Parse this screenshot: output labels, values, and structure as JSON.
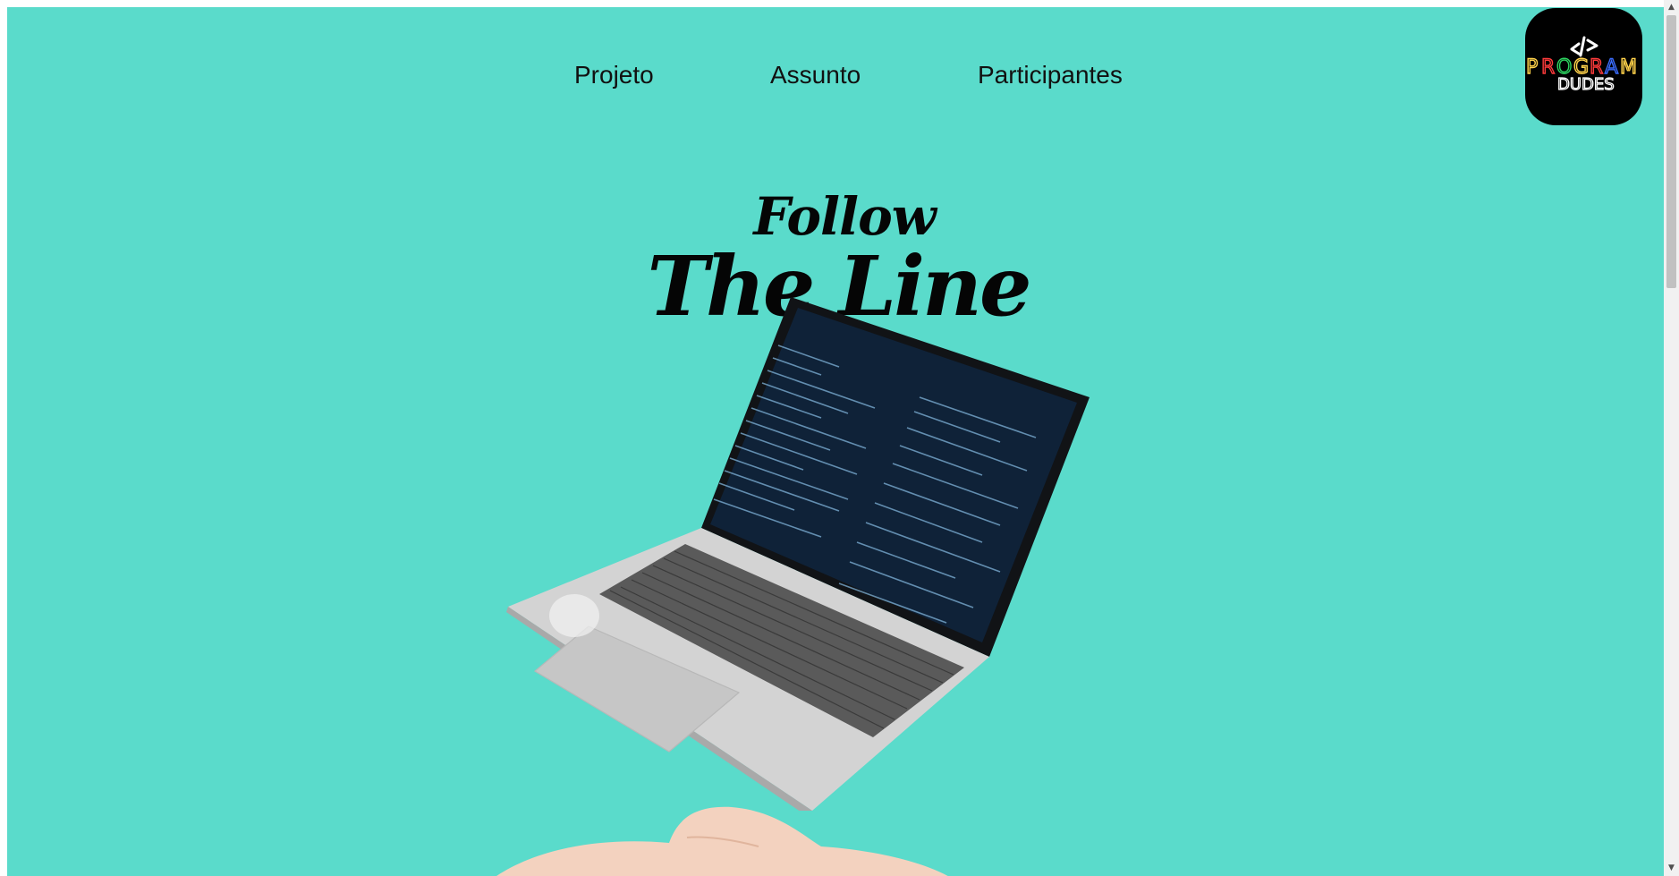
{
  "nav": {
    "items": [
      {
        "label": "Projeto"
      },
      {
        "label": "Assunto"
      },
      {
        "label": "Participantes"
      }
    ]
  },
  "logo": {
    "line1": "PROGRAM",
    "line2": "DUDES",
    "icon": "code-brackets-icon"
  },
  "hero": {
    "title_line1": "Follow",
    "title_line2": "The Line"
  },
  "colors": {
    "background": "#5ADBCB",
    "text": "#111111",
    "logo_bg": "#000000"
  },
  "scrollbar": {
    "up_icon": "chevron-up-icon",
    "down_icon": "chevron-down-icon"
  }
}
